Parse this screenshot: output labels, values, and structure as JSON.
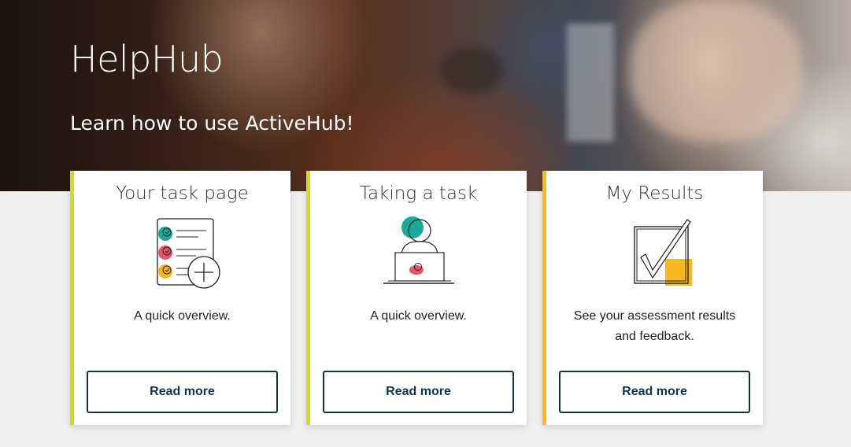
{
  "hero": {
    "title": "HelpHub",
    "subtitle": "Learn how to use ActiveHub!"
  },
  "cards": [
    {
      "title": "Your task page",
      "description": "A quick overview.",
      "button_label": "Read more",
      "icon": "task-list-icon",
      "accent_color": "#d2db1f"
    },
    {
      "title": "Taking a task",
      "description": "A quick overview.",
      "button_label": "Read more",
      "icon": "person-at-laptop-icon",
      "accent_color": "#d2db1f"
    },
    {
      "title": "My Results",
      "description": "See your assessment results and feedback.",
      "button_label": "Read more",
      "icon": "checkbox-checked-icon",
      "accent_color": "#f5bc1c"
    }
  ],
  "colors": {
    "button_border": "#11324a",
    "teal": "#1aaa9a",
    "red": "#e5566a",
    "yellow": "#f7b81f"
  }
}
